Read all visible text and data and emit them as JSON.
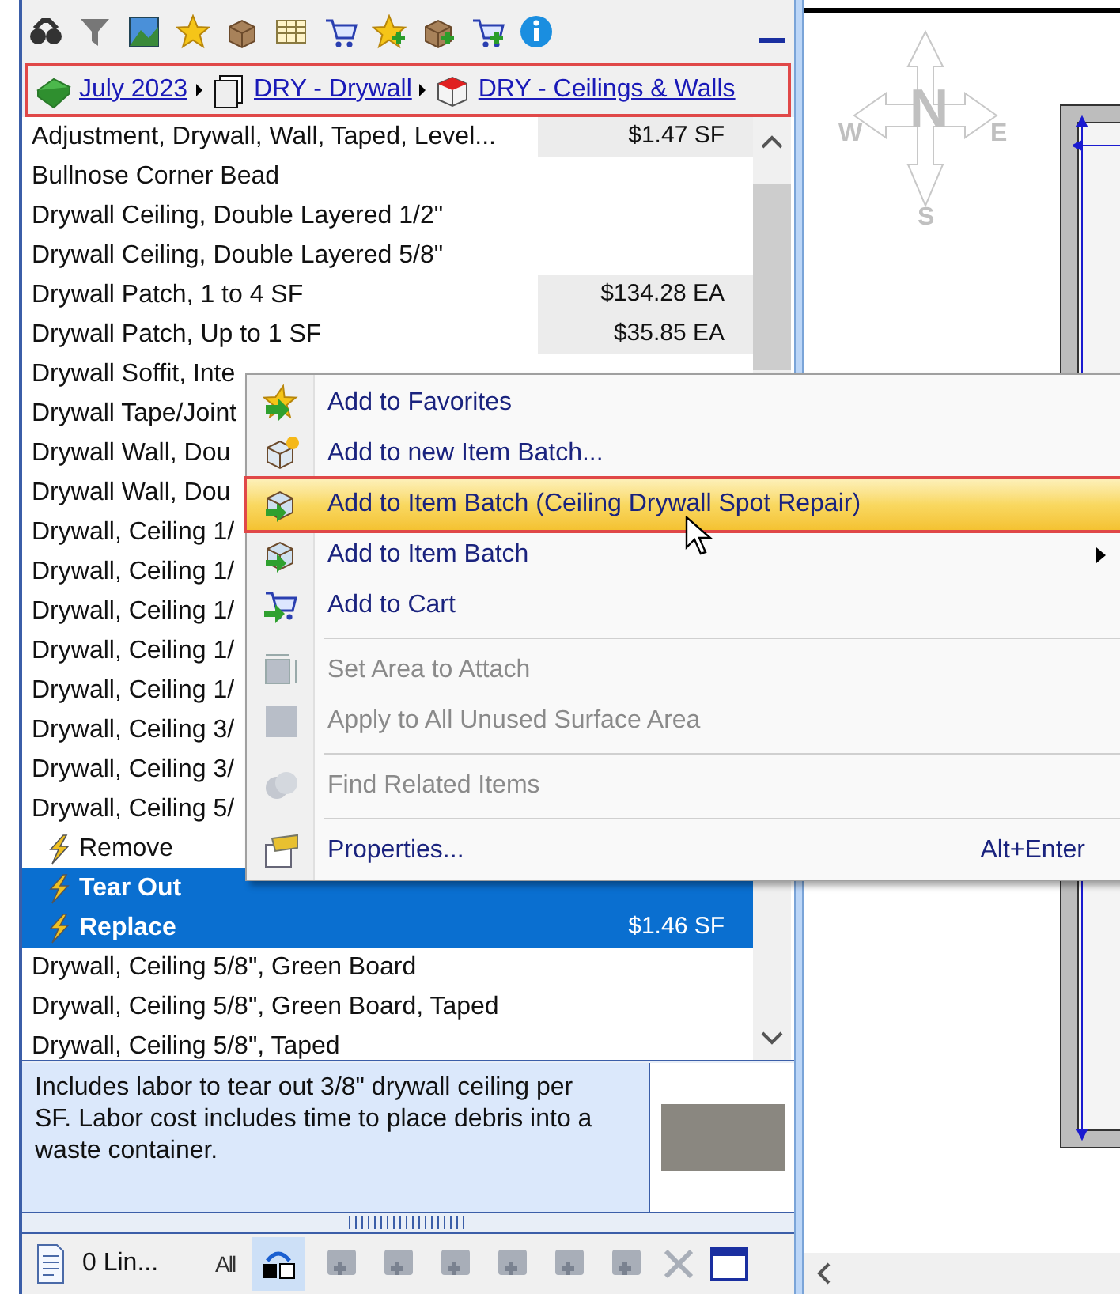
{
  "breadcrumb": [
    {
      "label": "July 2023",
      "kind": "book"
    },
    {
      "label": "DRY - Drywall",
      "kind": "folder"
    },
    {
      "label": "DRY - Ceilings & Walls",
      "kind": "box"
    }
  ],
  "items": [
    {
      "label": "Adjustment, Drywall, Wall, Taped, Level...",
      "price": "$1.47 SF"
    },
    {
      "label": "Bullnose Corner Bead"
    },
    {
      "label": "Drywall Ceiling, Double Layered 1/2\""
    },
    {
      "label": "Drywall Ceiling, Double Layered 5/8\""
    },
    {
      "label": "Drywall Patch, 1 to 4 SF",
      "price": "$134.28 EA"
    },
    {
      "label": "Drywall Patch, Up to 1 SF",
      "price": "$35.85 EA"
    },
    {
      "label": "Drywall Soffit, Inte"
    },
    {
      "label": "Drywall Tape/Joint"
    },
    {
      "label": "Drywall Wall, Dou"
    },
    {
      "label": "Drywall Wall, Dou"
    },
    {
      "label": "Drywall, Ceiling 1/"
    },
    {
      "label": "Drywall, Ceiling 1/"
    },
    {
      "label": "Drywall, Ceiling 1/"
    },
    {
      "label": "Drywall, Ceiling 1/"
    },
    {
      "label": "Drywall, Ceiling 1/"
    },
    {
      "label": "Drywall, Ceiling 3/"
    },
    {
      "label": "Drywall, Ceiling 3/"
    },
    {
      "label": "Drywall, Ceiling 5/",
      "children": [
        {
          "label": "Remove",
          "selected": false
        },
        {
          "label": "Tear Out",
          "selected": true
        },
        {
          "label": "Replace",
          "price": "$1.46 SF",
          "selected": true
        }
      ]
    },
    {
      "label": "Drywall, Ceiling 5/8\", Green Board"
    },
    {
      "label": "Drywall, Ceiling 5/8\", Green Board, Taped"
    },
    {
      "label": "Drywall, Ceiling 5/8\", Taped"
    }
  ],
  "description": "Includes labor to tear out 3/8\" drywall ceiling per SF.  Labor cost includes time to place debris into a waste container.",
  "bottom_bar": {
    "line_count": "0 Lin...",
    "filter": "All"
  },
  "context_menu": [
    {
      "kind": "item",
      "label": "Add to Favorites",
      "disabled": false,
      "selected": false
    },
    {
      "kind": "item",
      "label": "Add to new Item Batch...",
      "disabled": false,
      "selected": false
    },
    {
      "kind": "item",
      "label": "Add to Item Batch (Ceiling Drywall Spot Repair)",
      "disabled": false,
      "selected": true
    },
    {
      "kind": "item",
      "label": "Add to Item Batch",
      "disabled": false,
      "selected": false,
      "submenu": true
    },
    {
      "kind": "item",
      "label": "Add to Cart",
      "disabled": false,
      "selected": false
    },
    {
      "kind": "separator"
    },
    {
      "kind": "item",
      "label": "Set Area to Attach",
      "disabled": true,
      "selected": false
    },
    {
      "kind": "item",
      "label": "Apply to All Unused Surface Area",
      "disabled": true,
      "selected": false
    },
    {
      "kind": "separator"
    },
    {
      "kind": "item",
      "label": "Find Related Items",
      "disabled": true,
      "selected": false
    },
    {
      "kind": "separator"
    },
    {
      "kind": "item",
      "label": "Properties...",
      "disabled": false,
      "selected": false,
      "shortcut": "Alt+Enter"
    }
  ],
  "compass": {
    "north": "N",
    "east": "E",
    "south": "S",
    "west": "W"
  }
}
